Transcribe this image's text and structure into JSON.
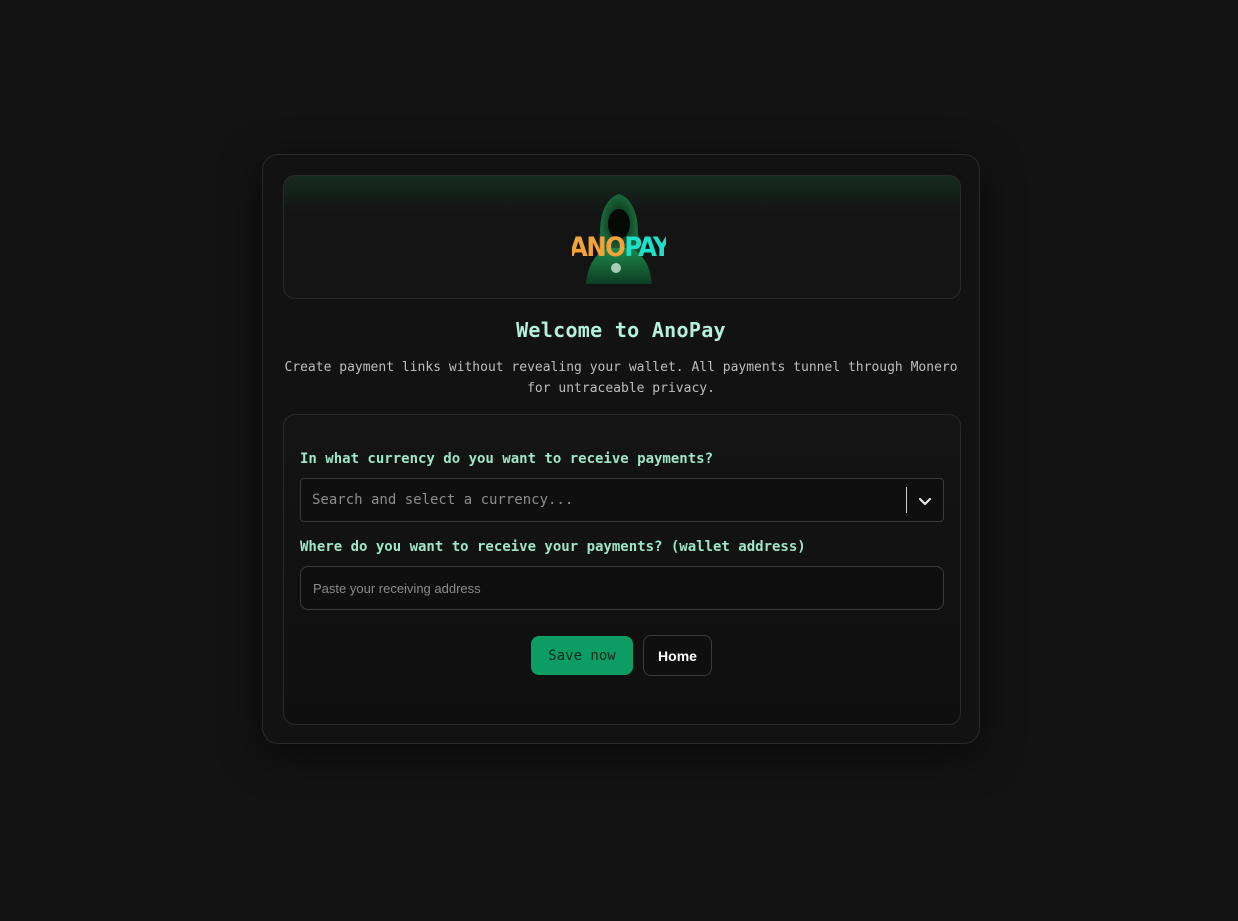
{
  "hero": {
    "logo_text_left": "ANO",
    "logo_text_right": "PAY",
    "logo_colors": {
      "left": "#f2a33a",
      "right": "#1ee0c8",
      "hood": "#1a6b3c"
    }
  },
  "title": "Welcome to AnoPay",
  "description": "Create payment links without revealing your wallet. All payments tunnel through Monero for untraceable privacy.",
  "form": {
    "currency_label": "In what currency do you want to receive payments?",
    "currency_placeholder": "Search and select a currency...",
    "wallet_label": "Where do you want to receive your payments? (wallet address)",
    "wallet_placeholder": "Paste your receiving address",
    "wallet_value": "",
    "save_label": "Save now",
    "home_label": "Home"
  },
  "colors": {
    "accent": "#0c9d62",
    "label": "#9ee6c8",
    "title": "#b4f0dd",
    "background": "#131313"
  },
  "icons": {
    "dropdown": "chevron-down-icon"
  }
}
